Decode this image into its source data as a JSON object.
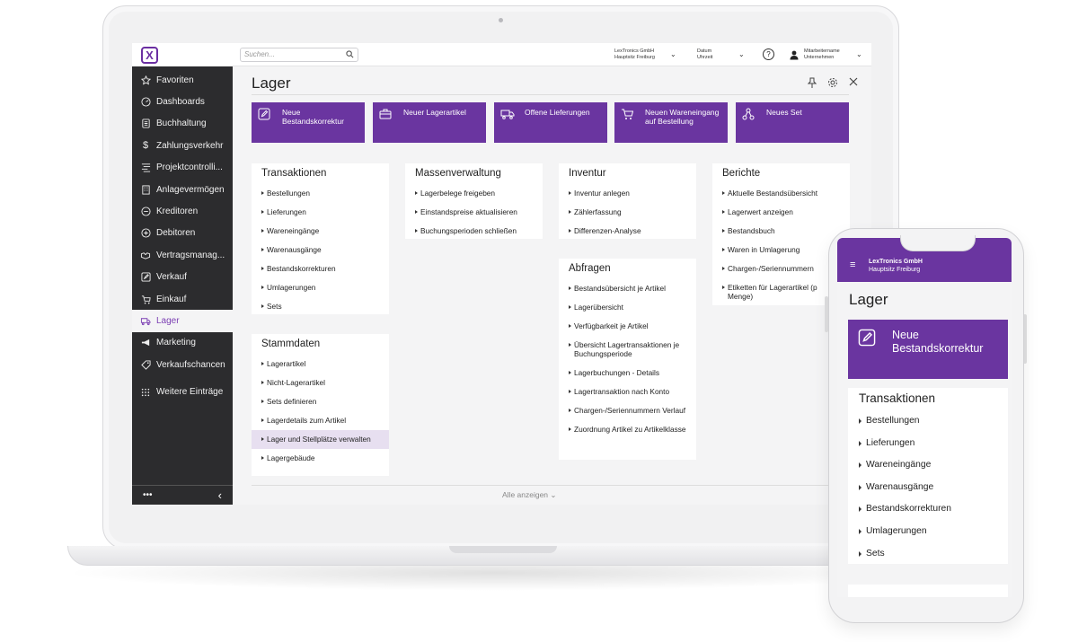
{
  "app": {
    "logo_letter": "X",
    "search_placeholder": "Suchen...",
    "company_line1": "LexTronics GmbH",
    "company_line2": "Hauptsitz Freiburg",
    "date_line1": "Datum",
    "date_line2": "Uhrzeit",
    "help": "?",
    "user_line1": "Mitarbeitername",
    "user_line2": "Unternehmen"
  },
  "sidebar": {
    "items": [
      {
        "label": "Favoriten",
        "icon": "star-icon"
      },
      {
        "label": "Dashboards",
        "icon": "gauge-icon"
      },
      {
        "label": "Buchhaltung",
        "icon": "ledger-icon"
      },
      {
        "label": "Zahlungsverkehr",
        "icon": "dollar-icon"
      },
      {
        "label": "Projektcontrolli...",
        "icon": "project-icon"
      },
      {
        "label": "Anlagevermögen",
        "icon": "building-icon"
      },
      {
        "label": "Kreditoren",
        "icon": "minus-circle-icon"
      },
      {
        "label": "Debitoren",
        "icon": "plus-circle-icon"
      },
      {
        "label": "Vertragsmanag...",
        "icon": "handshake-icon"
      },
      {
        "label": "Verkauf",
        "icon": "edit-icon"
      },
      {
        "label": "Einkauf",
        "icon": "cart-icon"
      },
      {
        "label": "Lager",
        "icon": "truck-icon",
        "active": true
      },
      {
        "label": "Marketing",
        "icon": "megaphone-icon"
      },
      {
        "label": "Verkaufschancen",
        "icon": "tag-icon"
      }
    ],
    "more": "Weitere Einträge",
    "bottom_dots": "•••",
    "collapse": "‹"
  },
  "page": {
    "title": "Lager",
    "tiles": [
      {
        "label": "Neue Bestandskorrektur",
        "icon": "edit-icon"
      },
      {
        "label": "Neuer Lagerartikel",
        "icon": "briefcase-icon"
      },
      {
        "label": "Offene Lieferungen",
        "icon": "truck-icon"
      },
      {
        "label": "Neuen Wareneingang auf Bestellung",
        "icon": "cart-icon"
      },
      {
        "label": "Neues Set",
        "icon": "nodes-icon"
      }
    ],
    "panels": {
      "transaktionen": {
        "title": "Transaktionen",
        "items": [
          "Bestellungen",
          "Lieferungen",
          "Wareneingänge",
          "Warenausgänge",
          "Bestandskorrekturen",
          "Umlagerungen",
          "Sets"
        ]
      },
      "stammdaten": {
        "title": "Stammdaten",
        "items": [
          "Lagerartikel",
          "Nicht-Lagerartikel",
          "Sets definieren",
          "Lagerdetails zum Artikel",
          "Lager und Stellplätze verwalten",
          "Lagergebäude"
        ]
      },
      "massenverwaltung": {
        "title": "Massenverwaltung",
        "items": [
          "Lagerbelege freigeben",
          "Einstandspreise aktualisieren",
          "Buchungsperioden schließen"
        ]
      },
      "inventur": {
        "title": "Inventur",
        "items": [
          "Inventur anlegen",
          "Zählerfassung",
          "Differenzen-Analyse"
        ]
      },
      "abfragen": {
        "title": "Abfragen",
        "items": [
          "Bestandsübersicht je Artikel",
          "Lagerübersicht",
          "Verfügbarkeit je Artikel",
          "Übersicht Lagertransaktionen je Buchungsperiode",
          "Lagerbuchungen - Details",
          "Lagertransaktion nach Konto",
          "Chargen-/Seriennummern Verlauf",
          "Zuordnung Artikel zu Artikelklasse"
        ]
      },
      "berichte": {
        "title": "Berichte",
        "items": [
          "Aktuelle Bestandsübersicht",
          "Lagerwert anzeigen",
          "Bestandsbuch",
          "Waren in Umlagerung",
          "Chargen-/Seriennummern",
          "Etiketten für Lagerartikel (p Menge)"
        ]
      }
    },
    "show_all": "Alle anzeigen"
  },
  "phone": {
    "company_line1": "LexTronics GmbH",
    "company_line2": "Hauptsitz Freiburg",
    "title": "Lager",
    "tile_label": "Neue Bestandskorrektur",
    "panel_title": "Transaktionen",
    "items": [
      "Bestellungen",
      "Lieferungen",
      "Wareneingänge",
      "Warenausgänge",
      "Bestandskorrekturen",
      "Umlagerungen",
      "Sets"
    ]
  },
  "colors": {
    "brand": "#6a35a0",
    "sidebar": "#2c2c2e",
    "highlight": "#e7dff0"
  }
}
